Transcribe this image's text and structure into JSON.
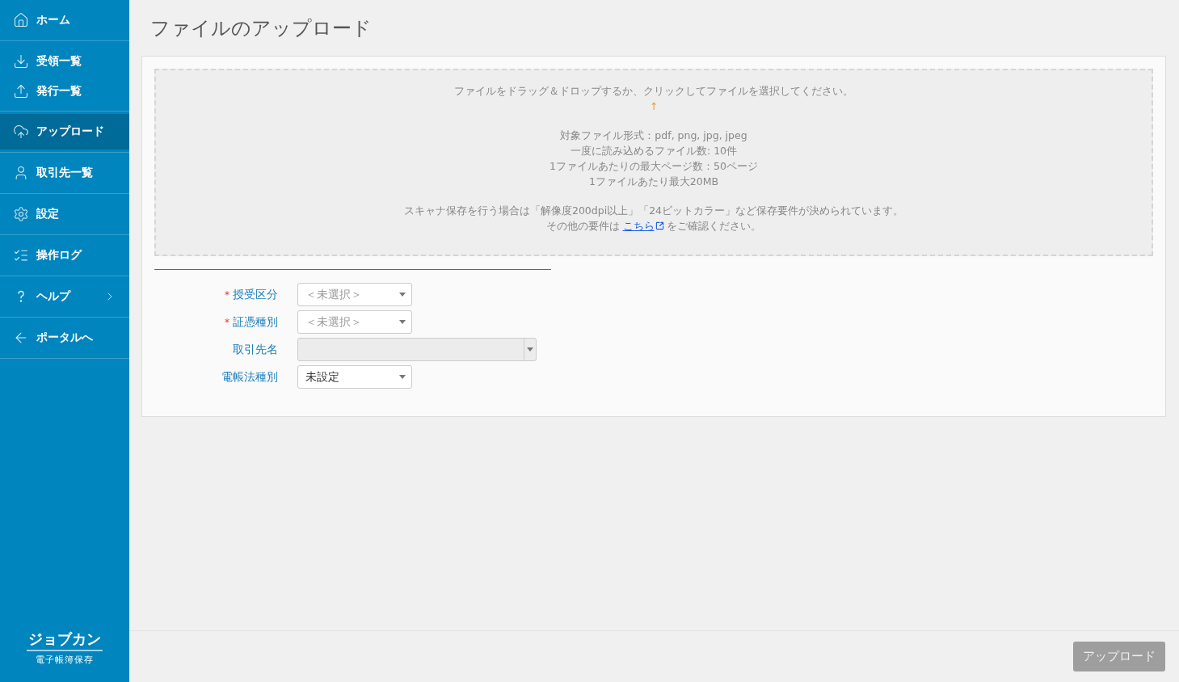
{
  "sidebar": {
    "groups": [
      {
        "items": [
          {
            "label": "ホーム",
            "selected": false
          }
        ]
      },
      {
        "items": [
          {
            "label": "受領一覧",
            "selected": false
          },
          {
            "label": "発行一覧",
            "selected": false
          }
        ]
      },
      {
        "items": [
          {
            "label": "アップロード",
            "selected": true
          }
        ]
      },
      {
        "items": [
          {
            "label": "取引先一覧",
            "selected": false
          }
        ]
      },
      {
        "items": [
          {
            "label": "設定",
            "selected": false
          }
        ]
      },
      {
        "items": [
          {
            "label": "操作ログ",
            "selected": false
          }
        ]
      },
      {
        "items": [
          {
            "label": "ヘルプ",
            "selected": false,
            "expandable": true
          }
        ]
      },
      {
        "items": [
          {
            "label": "ポータルへ",
            "selected": false
          }
        ]
      }
    ],
    "logo": {
      "name": "ジョブカン",
      "sub": "電子帳簿保存"
    }
  },
  "page": {
    "title": "ファイルのアップロード"
  },
  "dropzone": {
    "prompt": "ファイルをドラッグ＆ドロップするか、クリックしてファイルを選択してください。",
    "arrow": "↑",
    "specs": [
      "対象ファイル形式：pdf, png, jpg, jpeg",
      "一度に読み込めるファイル数: 10件",
      "1ファイルあたりの最大ページ数：50ページ",
      "1ファイルあたり最大20MB"
    ],
    "note": "スキャナ保存を行う場合は「解像度200dpi以上」「24ビットカラー」など保存要件が決められています。",
    "more": {
      "before": "その他の要件は",
      "link": "こちら",
      "after": "をご確認ください。"
    }
  },
  "form": {
    "required_mark": "*",
    "fields": [
      {
        "label": "授受区分",
        "required": true,
        "kind": "select",
        "placeholder": "＜未選択＞",
        "disabled": false
      },
      {
        "label": "証憑種別",
        "required": true,
        "kind": "select",
        "placeholder": "＜未選択＞",
        "disabled": false
      },
      {
        "label": "取引先名",
        "required": false,
        "kind": "combo",
        "disabled": true
      },
      {
        "label": "電帳法種別",
        "required": false,
        "kind": "select",
        "value": "未設定",
        "disabled": false
      }
    ]
  },
  "footer": {
    "upload_button": {
      "label": "アップロード",
      "disabled": true
    }
  }
}
